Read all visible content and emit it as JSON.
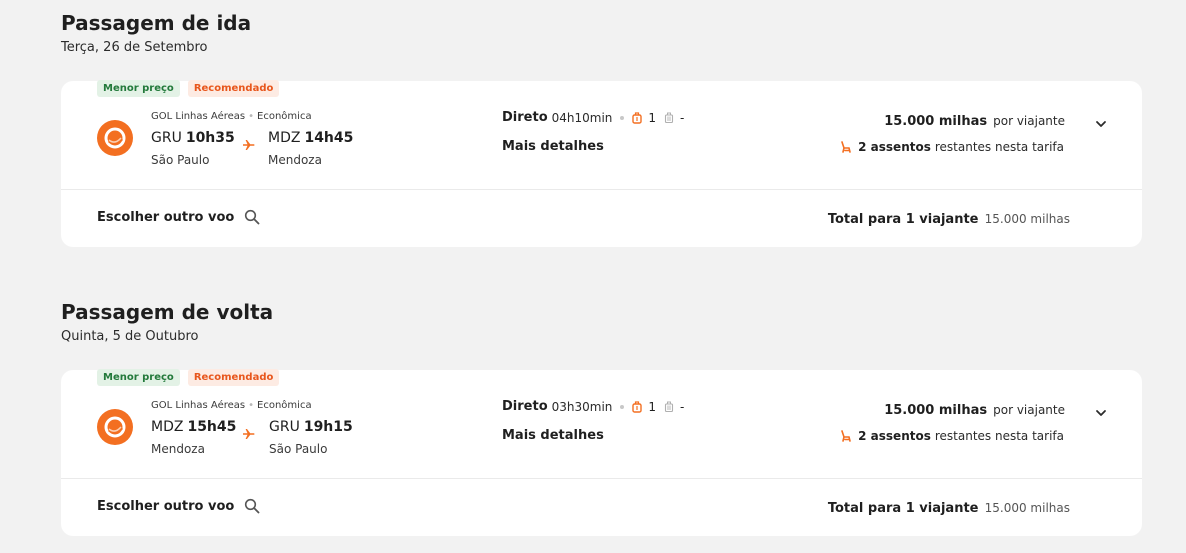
{
  "outbound": {
    "title": "Passagem de ida",
    "date": "Terça, 26 de Setembro",
    "badges": {
      "lowest": "Menor preço",
      "recommended": "Recomendado"
    },
    "airline": "GOL Linhas Aéreas",
    "cabin": "Econômica",
    "origin": {
      "code": "GRU",
      "time": "10h35",
      "city": "São Paulo"
    },
    "destination": {
      "code": "MDZ",
      "time": "14h45",
      "city": "Mendoza"
    },
    "direct_label": "Direto",
    "duration": "04h10min",
    "bags": "1",
    "carry_on": "-",
    "details_label": "Mais detalhes",
    "price_miles": "15.000 milhas",
    "price_per": "por viajante",
    "seats_count": "2 assentos",
    "seats_rest": "restantes nesta tarifa",
    "choose_other": "Escolher outro voo",
    "total_label": "Total para 1 viajante",
    "total_value": "15.000 milhas"
  },
  "inbound": {
    "title": "Passagem de volta",
    "date": "Quinta, 5 de Outubro",
    "badges": {
      "lowest": "Menor preço",
      "recommended": "Recomendado"
    },
    "airline": "GOL Linhas Aéreas",
    "cabin": "Econômica",
    "origin": {
      "code": "MDZ",
      "time": "15h45",
      "city": "Mendoza"
    },
    "destination": {
      "code": "GRU",
      "time": "19h15",
      "city": "São Paulo"
    },
    "direct_label": "Direto",
    "duration": "03h30min",
    "bags": "1",
    "carry_on": "-",
    "details_label": "Mais detalhes",
    "price_miles": "15.000 milhas",
    "price_per": "por viajante",
    "seats_count": "2 assentos",
    "seats_rest": "restantes nesta tarifa",
    "choose_other": "Escolher outro voo",
    "total_label": "Total para 1 viajante",
    "total_value": "15.000 milhas"
  },
  "icons": {
    "airline_logo": "gol-logo-icon",
    "plane": "airplane-icon",
    "bag": "checked-bag-icon",
    "carry_on": "carry-on-bag-icon",
    "seat": "seat-icon",
    "chevron": "chevron-down-icon",
    "search": "search-icon"
  },
  "colors": {
    "accent": "#f36f21",
    "badge_green_text": "#237a3b",
    "badge_orange_text": "#e8561c"
  }
}
